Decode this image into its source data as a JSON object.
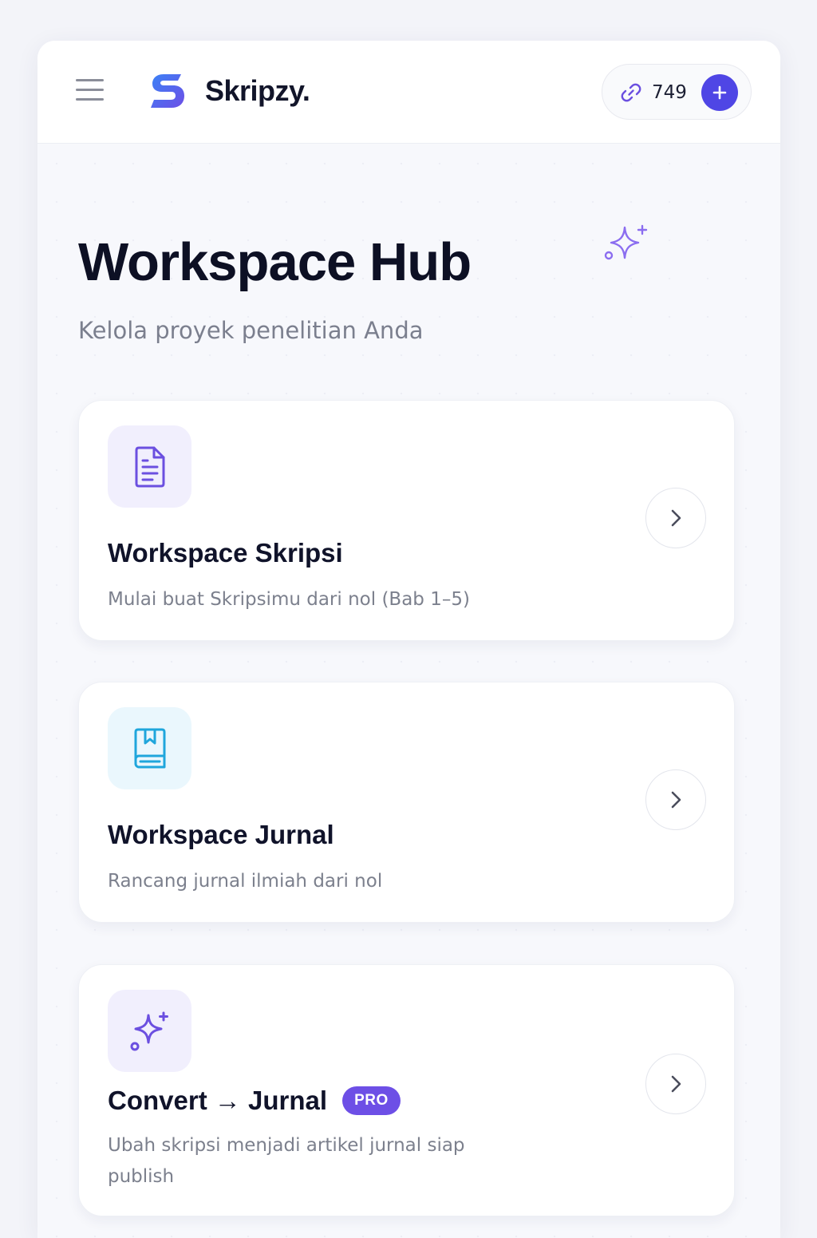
{
  "header": {
    "brand_name": "Skripzy.",
    "credits": "749",
    "add_credit_symbol": "+"
  },
  "page": {
    "title": "Workspace Hub",
    "subtitle": "Kelola proyek penelitian Anda"
  },
  "cards": [
    {
      "title": "Workspace Skripsi",
      "description": "Mulai buat Skripsimu dari nol (Bab 1–5)",
      "icon": "document-icon",
      "icon_bg": "#f1effd",
      "icon_color": "#6b4fe0"
    },
    {
      "title": "Workspace Jurnal",
      "description": "Rancang jurnal ilmiah dari nol",
      "icon": "book-icon",
      "icon_bg": "#eaf7fd",
      "icon_color": "#1fa6dc"
    },
    {
      "title": "Convert → Jurnal",
      "badge": "PRO",
      "description": "Ubah skripsi menjadi artikel jurnal siap publish",
      "icon": "sparkle-icon",
      "icon_bg": "#f1effd",
      "icon_color": "#6b4fe0"
    }
  ],
  "colors": {
    "accent": "#4f46e5",
    "badge": "#6d4fe6",
    "logo_blue": "#3b82f6",
    "logo_purple": "#6d4fe6"
  }
}
